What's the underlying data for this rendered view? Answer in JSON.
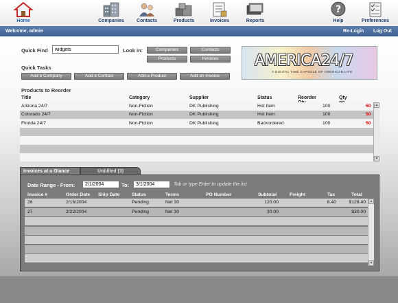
{
  "nav": {
    "home": "Home",
    "companies": "Companies",
    "contacts": "Contacts",
    "products": "Products",
    "invoices": "Invoices",
    "reports": "Reports",
    "help": "Help",
    "preferences": "Preferences"
  },
  "welcome": {
    "text": "Welcome, admin",
    "relogin": "Re-Login",
    "logout": "Log Out"
  },
  "quickfind": {
    "label": "Quick Find",
    "value": "widgets",
    "lookin": "Look in:"
  },
  "lookin_buttons": [
    "Companies",
    "Contacts",
    "Products",
    "Invoices"
  ],
  "quicktasks": {
    "label": "Quick Tasks",
    "buttons": [
      "Add a Company",
      "Add a Contact",
      "Add a Product",
      "Add an Invoice"
    ]
  },
  "logo": {
    "brand": "AMERICA24/7",
    "tagline": "A DIGITAL TIME CAPSULE OF AMERICAN LIFE"
  },
  "reorder": {
    "title": "Products to Reorder",
    "columns": [
      "Title",
      "Category",
      "Supplier",
      "Status",
      "Reorder Qty",
      "Qty on Hand"
    ],
    "rows": [
      [
        "Arizona 24/7",
        "Non-Fiction",
        "DK Publishing",
        "Hot Item",
        "100",
        "50"
      ],
      [
        "Colorado 24/7",
        "Non-Fiction",
        "DK Publishing",
        "Hot Item",
        "100",
        "50"
      ],
      [
        "Florida 24/7",
        "Non-Fiction",
        "DK Publishing",
        "Backordered",
        "100",
        "50"
      ],
      [
        "",
        "",
        "",
        "",
        "",
        ""
      ],
      [
        "",
        "",
        "",
        "",
        "",
        ""
      ],
      [
        "",
        "",
        "",
        "",
        "",
        ""
      ],
      [
        "",
        "",
        "",
        "",
        "",
        ""
      ]
    ]
  },
  "invoices": {
    "tab_active": "Invoices at a Glance",
    "tab_inactive": "Unbilled (3)",
    "range_label": "Date Range - From:",
    "from": "2/1/2004",
    "to_label": "To:",
    "to": "3/1/2004",
    "hint": "Tab or type Enter to update the list",
    "columns": [
      "Invoice #",
      "Order Date",
      "Ship Date",
      "Status",
      "Terms",
      "PO Number",
      "Subtotal",
      "Freight",
      "Tax",
      "Total"
    ],
    "rows": [
      [
        "26",
        "2/16/2004",
        "",
        "Pending",
        "Net 30",
        "",
        "120.00",
        "",
        "8.40",
        "$128.40"
      ],
      [
        "27",
        "2/22/2004",
        "",
        "Pending",
        "Net 30",
        "",
        "30.00",
        "",
        "",
        "$30.00"
      ],
      [
        "",
        "",
        "",
        "",
        "",
        "",
        "",
        "",
        "",
        ""
      ],
      [
        "",
        "",
        "",
        "",
        "",
        "",
        "",
        "",
        "",
        ""
      ],
      [
        "",
        "",
        "",
        "",
        "",
        "",
        "",
        "",
        "",
        ""
      ],
      [
        "",
        "",
        "",
        "",
        "",
        "",
        "",
        "",
        "",
        ""
      ],
      [
        "",
        "",
        "",
        "",
        "",
        "",
        "",
        "",
        "",
        ""
      ]
    ]
  },
  "colors": {
    "header_blue": "#3c5f91",
    "alert_red": "#e00000"
  }
}
